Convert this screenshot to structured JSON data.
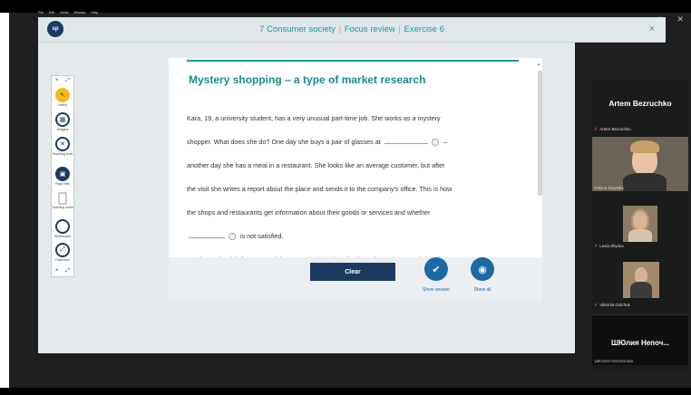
{
  "os": {
    "minimize": "–",
    "maximize": "↗",
    "close": "✕"
  },
  "app": {
    "menu": [
      "File",
      "Edit",
      "Home",
      "Window",
      "Help"
    ],
    "logo_text": "sp",
    "title_parts": [
      "7 Consumer society",
      "Focus review",
      "Exercise 6"
    ],
    "title_sep": "|",
    "close": "×"
  },
  "toolbar": {
    "top_left": "×",
    "top_right": "⤢",
    "items": [
      {
        "label": "Select",
        "glyph": "↖"
      },
      {
        "label": "Widgets",
        "glyph": "▦"
      },
      {
        "label": "Teaching tools",
        "glyph": "✕"
      },
      {
        "label": "Page view",
        "glyph": "▣"
      },
      {
        "label": "Teaching notes",
        "glyph": ""
      },
      {
        "label": "Whiteboard",
        "glyph": ""
      },
      {
        "label": "Fullscreen",
        "glyph": "⤢"
      }
    ],
    "bottom_left": "×",
    "bottom_right": "⤢"
  },
  "exercise": {
    "heading": "Mystery shopping – a type of market research",
    "line1": "Kara, 19, a university student, has a very unusual part-time job. She works as a mystery",
    "line2": "shopper. What does she do? One day she buys a pair of glasses at",
    "line2b": "–",
    "line3": "another day she has a meal in a restaurant. She looks like an average customer, but after",
    "line4": "the visit she writes a report about the place and sends it to the company's office. This is how",
    "line5": "the shops and restaurants get information about their goods or services and whether",
    "line6": "is not satisfied.",
    "line7": "'It's the perfect job for me', explains Kara. ' Going shopping has always been my hobby but I",
    "blank_icon": "○"
  },
  "footer": {
    "clear_label": "Clear",
    "show_answer_label": "Show answer",
    "show_all_label": "Show all",
    "check_glyph": "✔",
    "eye_glyph": "◉"
  },
  "zoom": {
    "host_name": "Artem Bezruchko",
    "participants": [
      {
        "name": "Artem Bezruchko"
      },
      {
        "name": "Galyna Zarytska"
      },
      {
        "name": "Lesia Zhylina"
      },
      {
        "name": "Viktoriia Golchuk"
      }
    ],
    "big_name": "ШЮлия Непоч...",
    "big_small": "ШЮлия Непочатова",
    "mic_glyph": "✗"
  }
}
